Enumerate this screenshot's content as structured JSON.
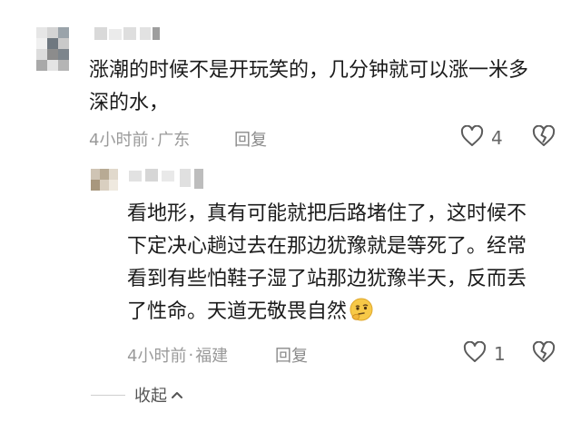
{
  "comments": [
    {
      "text": "涨潮的时候不是开玩笑的，几分钟就可以涨一米多\n深的水，",
      "time": "4小时前",
      "location": "广东",
      "reply_label": "回复",
      "likes": "4"
    },
    {
      "text": "看地形，真有可能就把后路堵住了，这时候不\n下定决心趟过去在那边犹豫就是等死了。经常\n看到有些怕鞋子湿了站那边犹豫半天，反而丢\n了性命。天道无敬畏自然",
      "time": "4小时前",
      "location": "福建",
      "reply_label": "回复",
      "likes": "1"
    }
  ],
  "meta_separator": "·",
  "collapse_label": "收起",
  "icons": {
    "like": "heart-outline-icon",
    "dislike": "broken-heart-icon",
    "collapse": "chevron-up-icon",
    "emoji": "thinking-face-emoji-icon"
  },
  "colors": {
    "text": "#1b1b1b",
    "meta": "#9a9a9a",
    "icon": "#5a5a5a"
  }
}
